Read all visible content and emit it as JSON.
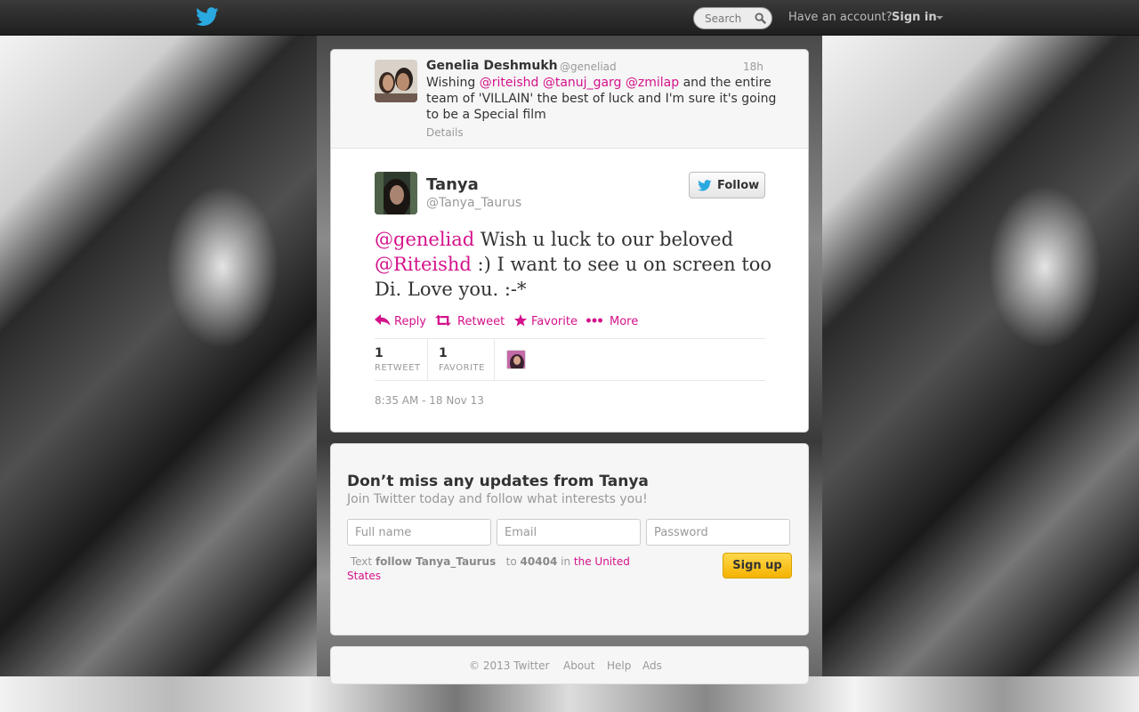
{
  "topbar": {
    "logo_icon": "twitter-bird-icon",
    "search": {
      "placeholder": "Search",
      "icon": "search-icon"
    },
    "have_account": "Have an account?",
    "signin_label": "Sign in"
  },
  "parent_tweet": {
    "name": "Genelia Deshmukh",
    "handle": "@geneliad",
    "time": "18h",
    "text_prefix": "Wishing ",
    "mention_1": "@riteishd",
    "mention_2": "@tanuj_garg",
    "mention_3": "@zmilap",
    "text_suffix": " and the entire team of 'VILLAIN' the best of luck and I'm sure it's going to be a Special film",
    "details_label": "Details"
  },
  "tweet": {
    "author_name": "Tanya",
    "author_handle": "@Tanya_Taurus",
    "follow_label": "Follow",
    "mention_1": "@geneliad",
    "text_1": " Wish u luck to our beloved ",
    "mention_2": "@Riteishd",
    "text_2": " :) I want to see u on screen too Di. Love you. :-*",
    "actions": {
      "reply": "Reply",
      "retweet": "Retweet",
      "favorite": "Favorite",
      "more": "More"
    },
    "stats": {
      "retweet_count": "1",
      "retweet_label": "RETWEET",
      "favorite_count": "1",
      "favorite_label": "FAVORITE"
    },
    "timestamp": "8:35 AM - 18 Nov 13"
  },
  "signup": {
    "title": "Don’t miss any updates from Tanya",
    "subtitle": "Join Twitter today and follow what interests you!",
    "fullname_placeholder": "Full name",
    "email_placeholder": "Email",
    "password_placeholder": "Password",
    "sms_text": "Text",
    "sms_command": "follow Tanya_Taurus",
    "sms_to": "to",
    "sms_number": "40404",
    "sms_in": "in",
    "sms_country": "the United States",
    "button_label": "Sign up"
  },
  "footer": {
    "copyright": "© 2013 Twitter",
    "about": "About",
    "help": "Help",
    "ads": "Ads"
  },
  "colors": {
    "accent": "#d4128b",
    "twitter_blue": "#1da1f2",
    "signup_yellow": "#f5b300"
  }
}
